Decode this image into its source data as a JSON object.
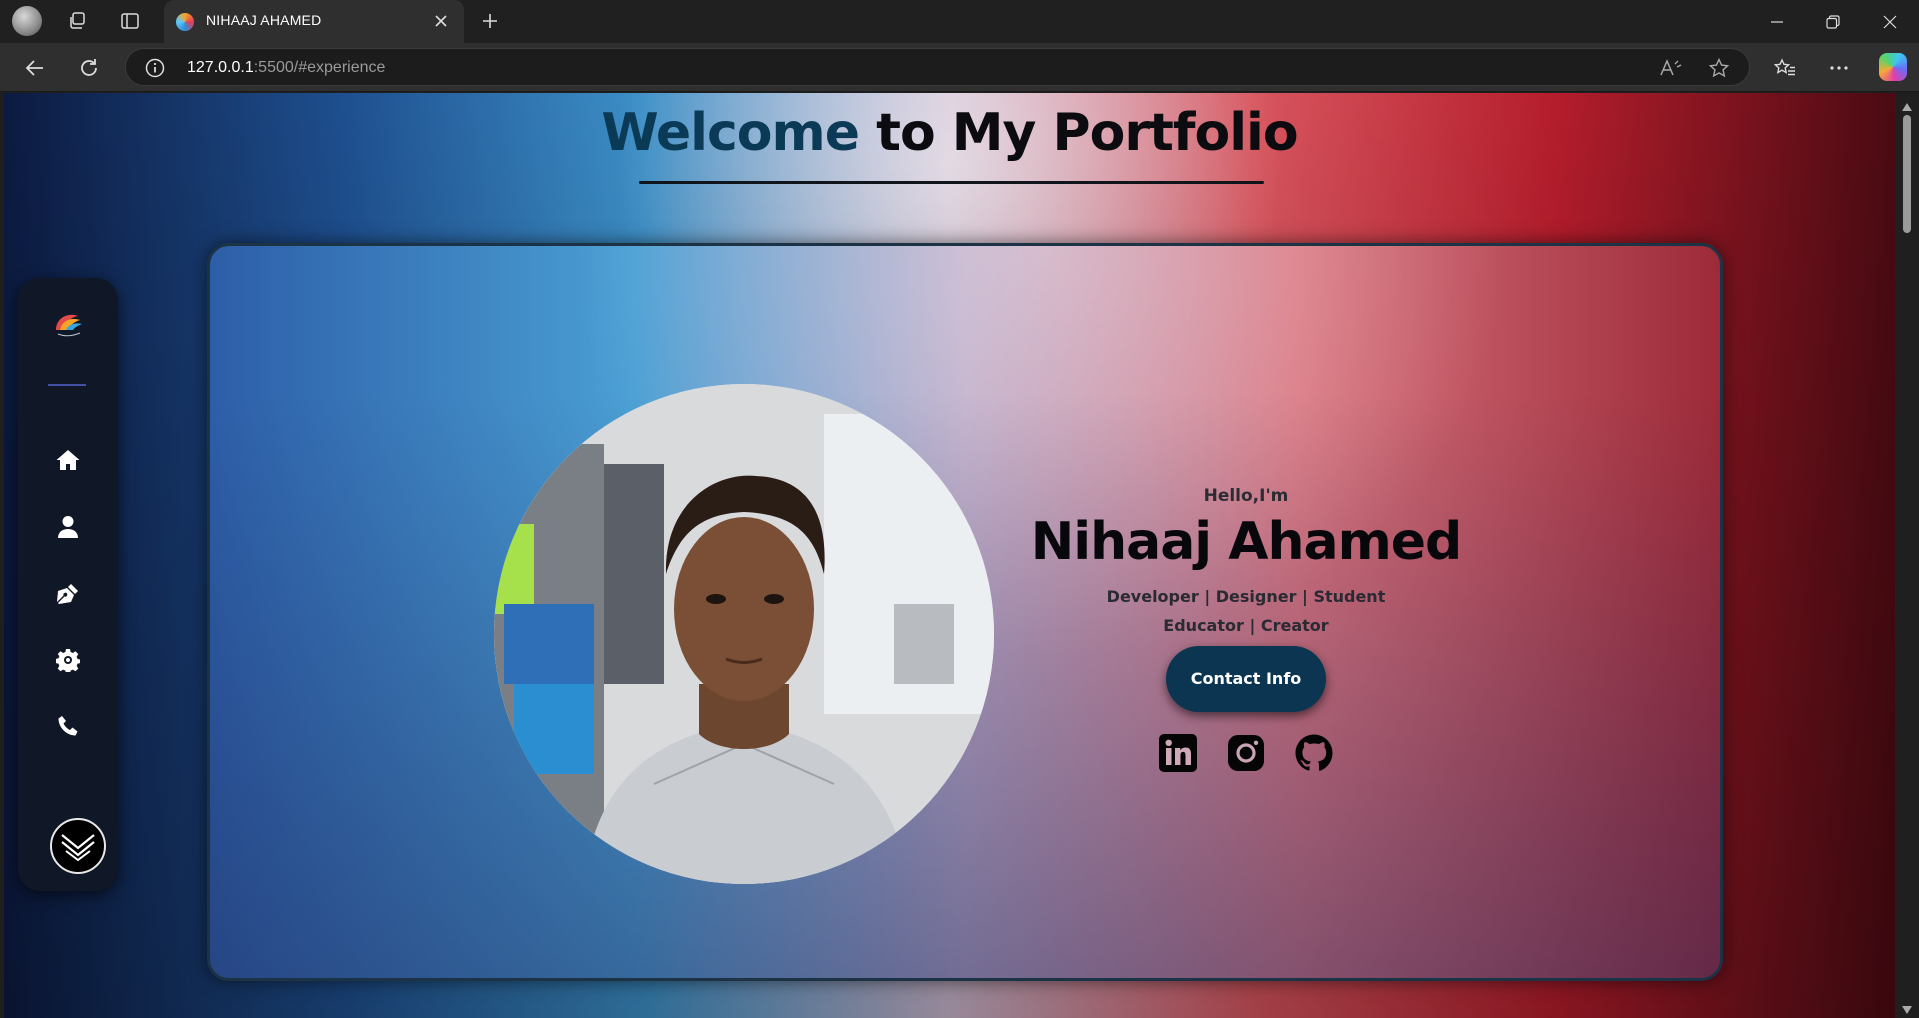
{
  "browser": {
    "tab_title": "NIHAAJ AHAMED",
    "url_host": "127.0.0.1",
    "url_rest": ":5500/#experience"
  },
  "page": {
    "heading_accent": "Welcome",
    "heading_rest": " to My Portfolio",
    "greeting": "Hello,I'm",
    "name": "Nihaaj Ahamed",
    "roles_line1": "Developer | Designer | Student",
    "roles_line2": "Educator | Creator",
    "contact_label": "Contact Info"
  },
  "sidebar": {
    "nav": [
      "home-icon",
      "user-icon",
      "pen-nib-icon",
      "gear-icon",
      "phone-icon"
    ]
  },
  "socials": [
    "linkedin-icon",
    "instagram-icon",
    "github-icon"
  ],
  "colors": {
    "heading_accent": "#0a3a55",
    "contact_button": "#0b3550",
    "sidebar": "#101726"
  }
}
